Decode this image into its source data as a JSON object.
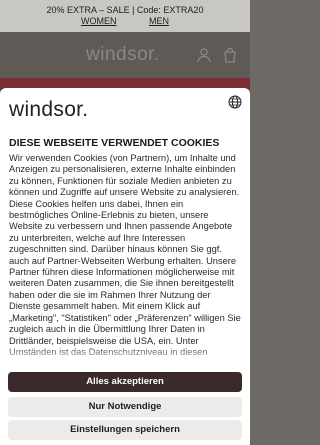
{
  "promo": {
    "line1": "20% EXTRA  –  SALE   |   Code:  EXTRA20",
    "women": "WOMEN",
    "men": "MEN"
  },
  "header": {
    "logo": "windsor."
  },
  "modal": {
    "logo": "windsor.",
    "title": "DIESE WEBSEITE VERWENDET COOKIES",
    "body": "Wir verwenden Cookies (von Partnern), um Inhalte und Anzeigen zu personalisieren, externe Inhalte einbinden zu können, Funktionen für soziale Medien anbieten zu können und Zugriffe auf unsere Website zu analysieren. Diese Cookies helfen uns dabei, Ihnen ein bestmögliches Online-Erlebnis zu bieten, unsere Website zu verbessern und Ihnen passende Angebote zu unterbreiten, welche auf Ihre Interessen zugeschnitten sind. Darüber hinaus können Sie ggf. auch auf Partner-Webseiten Werbung erhalten. Unsere Partner führen diese Informationen möglicherweise mit weiteren Daten zusammen, die Sie ihnen bereitgestellt haben oder die sie im Rahmen Ihrer Nutzung der Dienste gesammelt haben. Mit einem Klick auf „Marketing\", \"Statistiken\" oder „Präferenzen\" willigen Sie zugleich auch in die Übermittlung Ihrer Daten in Drittländer, beispielsweise die USA, ein. Unter Umständen ist das Datenschutzniveau in diesen",
    "accept_label": "Alles akzeptieren",
    "necessary_label": "Nur Notwendige",
    "settings_label": "Einstellungen speichern"
  },
  "colors": {
    "accept_button": "#3a2a2a",
    "secondary_button": "#ecebea",
    "overlay": "#6d6a66"
  }
}
